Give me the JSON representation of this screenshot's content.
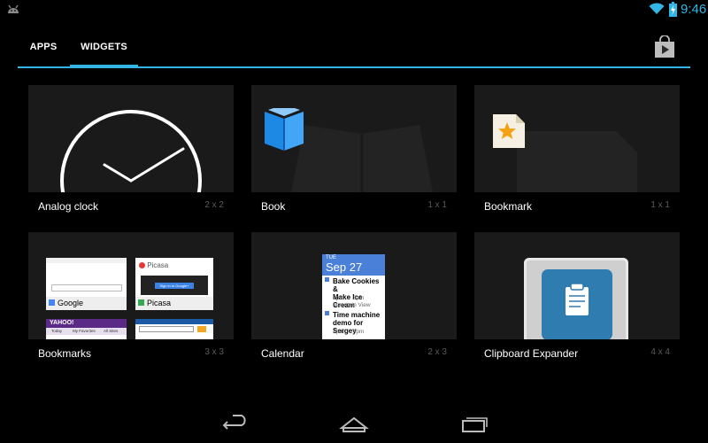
{
  "status_bar": {
    "time": "9:46"
  },
  "tabs": [
    {
      "label": "APPS",
      "selected": false
    },
    {
      "label": "WIDGETS",
      "selected": true
    }
  ],
  "colors": {
    "accent": "#33b5e5",
    "tile_bg": "#1a1a1a",
    "size_text": "#5a5a5a"
  },
  "icons": {
    "status_left": "android-debug-icon",
    "wifi": "wifi-icon",
    "battery": "battery-charging-icon",
    "market": "play-store-icon",
    "nav": [
      "back-icon",
      "home-icon",
      "recent-apps-icon"
    ]
  },
  "widgets": [
    {
      "name": "Analog clock",
      "size": "2 x 2"
    },
    {
      "name": "Book",
      "size": "1 x 1"
    },
    {
      "name": "Bookmark",
      "size": "1 x 1"
    },
    {
      "name": "Bookmarks",
      "size": "3 x 3"
    },
    {
      "name": "Calendar",
      "size": "2 x 3"
    },
    {
      "name": "Clipboard Expander",
      "size": "4 x 4"
    }
  ],
  "bookmarks_preview": {
    "google_label": "Google",
    "picasa_label": "Picasa",
    "picasa_header": "Picasa",
    "picasa_button": "Sign in to Google+",
    "google_logo": "Google",
    "yahoo_logo": "YAHOO!",
    "yahoo_tabs": [
      "Today",
      "My Favorites",
      "All Sites"
    ]
  },
  "calendar_preview": {
    "day": "TUE",
    "date": "Sep 27",
    "events": [
      {
        "title_lines": [
          "Bake Cookies &",
          "Make Ice Cream"
        ],
        "time": "2pm → 3pm",
        "location": "Mountain View"
      },
      {
        "title_lines": [
          "Time machine",
          "demo for Sergey"
        ],
        "time": "3pm → 4pm",
        "location": ""
      }
    ]
  }
}
